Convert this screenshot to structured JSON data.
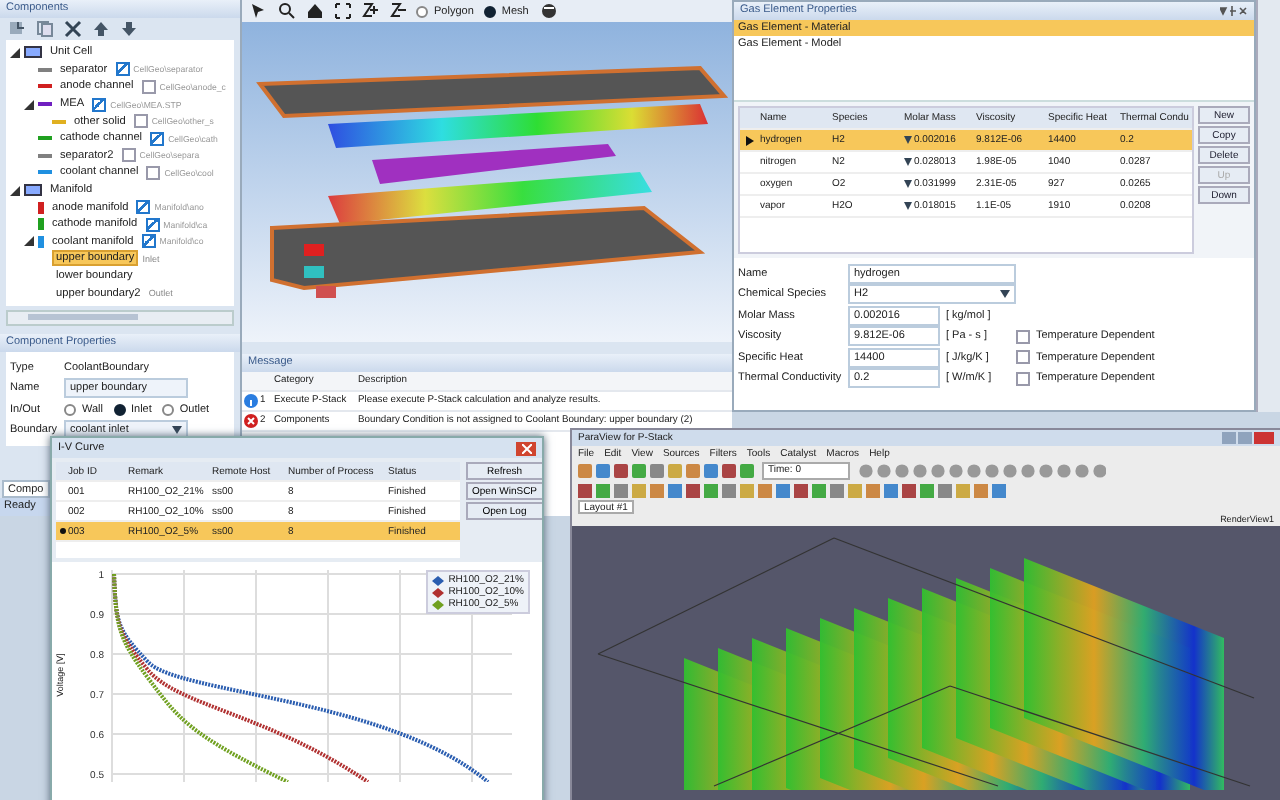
{
  "components_panel": {
    "title": "Components",
    "tree": [
      {
        "label": "Unit Cell",
        "kind": "group",
        "selected": false,
        "expanded": true,
        "children": [
          {
            "label": "separator",
            "kind": "part",
            "color": "#808080",
            "checked": true,
            "path": "CellGeo\\separator",
            "selected": false
          },
          {
            "label": "anode channel",
            "kind": "part",
            "color": "#d02020",
            "checked": false,
            "path": "CellGeo\\anode_c",
            "selected": false
          },
          {
            "label": "MEA",
            "kind": "part",
            "color": "#7020c0",
            "checked": true,
            "path": "CellGeo\\MEA.STP",
            "selected": false,
            "expanded": true,
            "children": [
              {
                "label": "other solid",
                "kind": "part",
                "color": "#e0b020",
                "checked": false,
                "path": "CellGeo\\other_s",
                "selected": false
              }
            ]
          },
          {
            "label": "cathode channel",
            "kind": "part",
            "color": "#20a020",
            "checked": true,
            "path": "CellGeo\\cath",
            "selected": false
          },
          {
            "label": "separator2",
            "kind": "part",
            "color": "#808080",
            "checked": false,
            "path": "CellGeo\\separa",
            "selected": false
          },
          {
            "label": "coolant channel",
            "kind": "part",
            "color": "#2090e0",
            "checked": false,
            "path": "CellGeo\\cool",
            "selected": false
          }
        ]
      },
      {
        "label": "Manifold",
        "kind": "group",
        "selected": false,
        "expanded": true,
        "children": [
          {
            "label": "anode manifold",
            "kind": "manifold",
            "color": "#d02020",
            "checked": true,
            "path": "Manifold\\ano",
            "selected": false
          },
          {
            "label": "cathode manifold",
            "kind": "manifold",
            "color": "#20a020",
            "checked": true,
            "path": "Manifold\\ca",
            "selected": false
          },
          {
            "label": "coolant manifold",
            "kind": "manifold",
            "color": "#2090e0",
            "checked": true,
            "path": "Manifold\\co",
            "selected": false,
            "expanded": true,
            "children": [
              {
                "label": "upper boundary",
                "kind": "boundary",
                "note": "Inlet",
                "selected": true
              },
              {
                "label": "lower boundary",
                "kind": "boundary",
                "selected": false
              },
              {
                "label": "upper boundary2",
                "kind": "boundary",
                "note": "Outlet",
                "selected": false
              }
            ]
          }
        ]
      }
    ]
  },
  "component_properties": {
    "title": "Component Properties",
    "type_label": "Type",
    "type_value": "CoolantBoundary",
    "name_label": "Name",
    "name_value": "upper boundary",
    "inout_label": "In/Out",
    "inout_options": [
      {
        "label": "Wall",
        "selected": false
      },
      {
        "label": "Inlet",
        "selected": true
      },
      {
        "label": "Outlet",
        "selected": false
      }
    ],
    "boundary_label": "Boundary",
    "boundary_value": "coolant inlet"
  },
  "bottom_tab": "Compo",
  "status_bar": "Ready",
  "viewport": {
    "modes": [
      {
        "label": "Polygon",
        "selected": false
      },
      {
        "label": "Mesh",
        "selected": true
      }
    ]
  },
  "message_panel": {
    "title": "Message",
    "columns": [
      "Category",
      "Description"
    ],
    "rows": [
      {
        "kind": "info",
        "number": "1",
        "category": "Execute P-Stack",
        "description": "Please execute P-Stack calculation and analyze results."
      },
      {
        "kind": "error",
        "number": "2",
        "category": "Components",
        "description": "Boundary Condition is not assigned to Coolant Boundary: upper boundary (2)"
      }
    ]
  },
  "gas_panel": {
    "title": "Gas Element Properties",
    "list": [
      {
        "label": "Gas Element - Material",
        "selected": true
      },
      {
        "label": "Gas Element - Model",
        "selected": false
      }
    ],
    "columns": [
      "Name",
      "Species",
      "Molar Mass",
      "Viscosity",
      "Specific Heat",
      "Thermal Condu"
    ],
    "rows": [
      {
        "selected": true,
        "cells": [
          "hydrogen",
          "H2",
          "0.002016",
          "9.812E-06",
          "14400",
          "0.2"
        ]
      },
      {
        "selected": false,
        "cells": [
          "nitrogen",
          "N2",
          "0.028013",
          "1.98E-05",
          "1040",
          "0.0287"
        ]
      },
      {
        "selected": false,
        "cells": [
          "oxygen",
          "O2",
          "0.031999",
          "2.31E-05",
          "927",
          "0.0265"
        ]
      },
      {
        "selected": false,
        "cells": [
          "vapor",
          "H2O",
          "0.018015",
          "1.1E-05",
          "1910",
          "0.0208"
        ]
      }
    ],
    "buttons": [
      {
        "label": "New",
        "disabled": false
      },
      {
        "label": "Copy",
        "disabled": false
      },
      {
        "label": "Delete",
        "disabled": false
      },
      {
        "label": "Up",
        "disabled": true
      },
      {
        "label": "Down",
        "disabled": false
      }
    ],
    "form": [
      {
        "kind": "text",
        "label": "Name",
        "value": "hydrogen"
      },
      {
        "kind": "select",
        "label": "Chemical Species",
        "value": "H2"
      },
      {
        "kind": "unit",
        "label": "Molar Mass",
        "value": "0.002016",
        "unit": "[ kg/mol ]"
      },
      {
        "kind": "unit",
        "label": "Viscosity",
        "value": "9.812E-06",
        "unit": "[ Pa - s ]",
        "option": "Temperature Dependent",
        "checked": false
      },
      {
        "kind": "unit",
        "label": "Specific Heat",
        "value": "14400",
        "unit": "[ J/kg/K ]",
        "option": "Temperature Dependent",
        "checked": false
      },
      {
        "kind": "unit",
        "label": "Thermal Conductivity",
        "value": "0.2",
        "unit": "[ W/m/K ]",
        "option": "Temperature Dependent",
        "checked": false
      }
    ]
  },
  "iv_window": {
    "title": "I-V Curve",
    "columns": [
      "Job ID",
      "Remark",
      "Remote Host",
      "Number of Process",
      "Status"
    ],
    "rows": [
      {
        "selected": false,
        "cells": [
          "001",
          "RH100_O2_21%",
          "ss00",
          "8",
          "Finished"
        ]
      },
      {
        "selected": false,
        "cells": [
          "002",
          "RH100_O2_10%",
          "ss00",
          "8",
          "Finished"
        ]
      },
      {
        "selected": true,
        "cells": [
          "003",
          "RH100_O2_5%",
          "ss00",
          "8",
          "Finished"
        ]
      }
    ],
    "buttons": [
      "Refresh",
      "Open WinSCP",
      "Open Log"
    ],
    "chart": {
      "ylabel": "Voltage [V]",
      "ytick_labels": [
        "1",
        "0.9",
        "0.8",
        "0.7",
        "0.6",
        "0.5"
      ],
      "legend": [
        {
          "name": "RH100_O2_21%",
          "color": "#2a5db0"
        },
        {
          "name": "RH100_O2_10%",
          "color": "#b03030"
        },
        {
          "name": "RH100_O2_5%",
          "color": "#70a020"
        }
      ]
    }
  },
  "paraview_window": {
    "title": "ParaView for P-Stack",
    "menu": [
      "File",
      "Edit",
      "View",
      "Sources",
      "Filters",
      "Tools",
      "Catalyst",
      "Macros",
      "Help"
    ],
    "time_label": "Time: 0",
    "tab": "Layout #1",
    "view_label": "RenderView1"
  }
}
